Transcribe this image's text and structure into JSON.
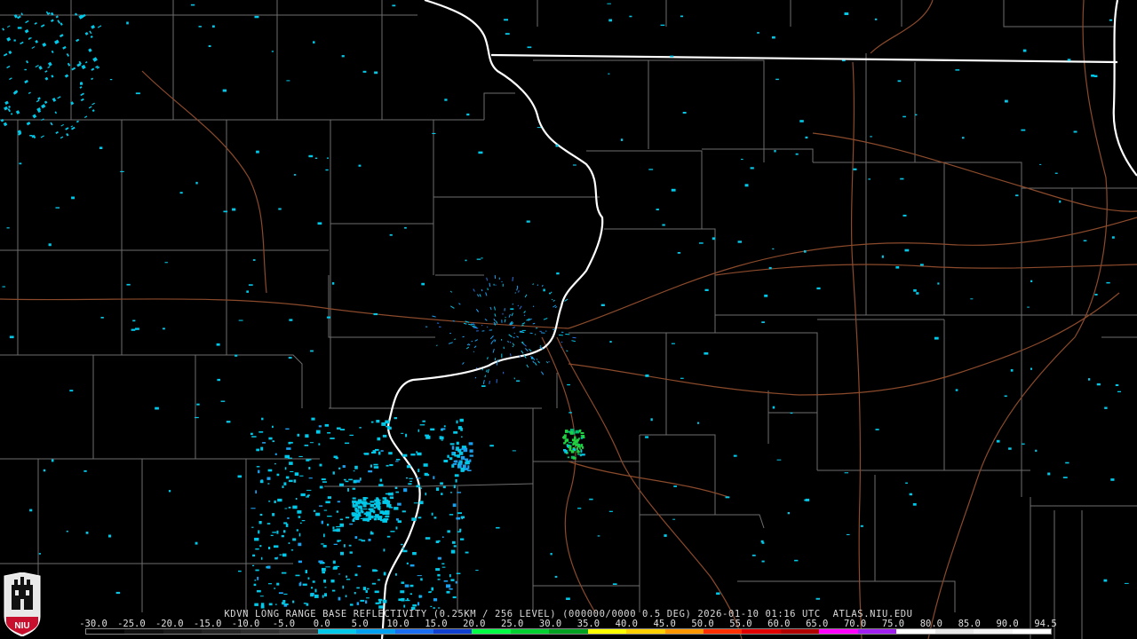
{
  "product": {
    "header": "KDVN LONG RANGE BASE REFLECTIVITY (0.25KM / 256 LEVEL) (000000/0000 0.5 DEG) 2026-01-10 01:16 UTC  ATLAS.NIU.EDU",
    "logo_text": "NIU"
  },
  "scale": {
    "tick_labels": [
      "-30.0",
      "-25.0",
      "-20.0",
      "-15.0",
      "-10.0",
      "-5.0",
      "0.0",
      "5.0",
      "10.0",
      "15.0",
      "20.0",
      "25.0",
      "30.0",
      "35.0",
      "40.0",
      "45.0",
      "50.0",
      "55.0",
      "60.0",
      "65.0",
      "70.0",
      "75.0",
      "80.0",
      "85.0",
      "90.0",
      "94.5"
    ],
    "colors": [
      "#000000",
      "#101010",
      "#1a1a1a",
      "#242424",
      "#2e2e2e",
      "#383838",
      "#00c8e8",
      "#00a0f0",
      "#1a6cf0",
      "#1040d0",
      "#00ff44",
      "#00d030",
      "#00a020",
      "#ffff00",
      "#ffd000",
      "#ff9800",
      "#ff3000",
      "#e00000",
      "#b00000",
      "#ff00ff",
      "#a020f0",
      "#ffffff",
      "#e8e8e8",
      "#f4f4f4",
      "#ffffff"
    ]
  },
  "map": {
    "background": "#000000",
    "county_line_color": "#707070",
    "state_line_color": "#ffffff",
    "highway_color": "#8b4a2b",
    "echo_colors": [
      "#00c8e8",
      "#1aa0f0",
      "#2a70e0",
      "#00b870",
      "#20d040"
    ]
  }
}
